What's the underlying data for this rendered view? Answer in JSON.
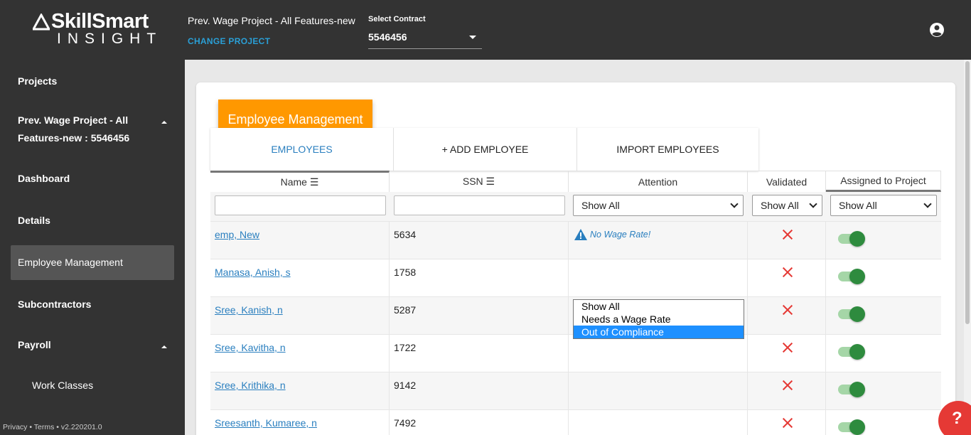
{
  "brand": {
    "name_top": "SkillSmart",
    "name_bottom": "INSIGHT"
  },
  "header": {
    "project_title": "Prev. Wage Project - All Features-new",
    "change_project": "CHANGE PROJECT",
    "contract_label": "Select Contract",
    "contract_value": "5546456"
  },
  "sidebar": {
    "items": [
      {
        "label": "Projects"
      },
      {
        "label": "Prev. Wage Project - All",
        "label2": "Features-new : 5546456"
      },
      {
        "label": "Dashboard"
      },
      {
        "label": "Details"
      },
      {
        "label": "Employee Management"
      },
      {
        "label": "Subcontractors"
      },
      {
        "label": "Payroll"
      },
      {
        "label": "Work Classes"
      }
    ],
    "footer": "Privacy • Terms • v2.220201.0"
  },
  "page": {
    "title": "Employee Management"
  },
  "tabs": [
    {
      "label": "EMPLOYEES"
    },
    {
      "label": "+ ADD EMPLOYEE"
    },
    {
      "label": "IMPORT EMPLOYEES"
    }
  ],
  "table": {
    "columns": [
      "Name ☰",
      "SSN ☰",
      "Attention",
      "Validated",
      "Assigned to Project"
    ],
    "filters": {
      "attention": "Show All",
      "validated": "Show All",
      "assigned": "Show All"
    },
    "rows": [
      {
        "name": "emp, New",
        "ssn": "5634",
        "attention": "No Wage Rate!",
        "validated": false,
        "assigned": true
      },
      {
        "name": "Manasa, Anish, s",
        "ssn": "1758",
        "attention": "",
        "validated": false,
        "assigned": true
      },
      {
        "name": "Sree, Kanish, n",
        "ssn": "5287",
        "attention": "",
        "validated": false,
        "assigned": true
      },
      {
        "name": "Sree, Kavitha, n",
        "ssn": "1722",
        "attention": "",
        "validated": false,
        "assigned": true
      },
      {
        "name": "Sree, Krithika, n",
        "ssn": "9142",
        "attention": "",
        "validated": false,
        "assigned": true
      },
      {
        "name": "Sreesanth, Kumaree, n",
        "ssn": "7492",
        "attention": "",
        "validated": false,
        "assigned": true
      }
    ]
  },
  "attention_dropdown": {
    "options": [
      "Show All",
      "Needs a Wage Rate",
      "Out of Compliance"
    ],
    "highlighted": "Out of Compliance"
  },
  "help": {
    "label": "?"
  },
  "colors": {
    "accent": "#ff9800",
    "sidebar": "#333333",
    "link": "#2a7fbf",
    "error": "#e53935",
    "toggle_on": "#2e8b3e"
  }
}
